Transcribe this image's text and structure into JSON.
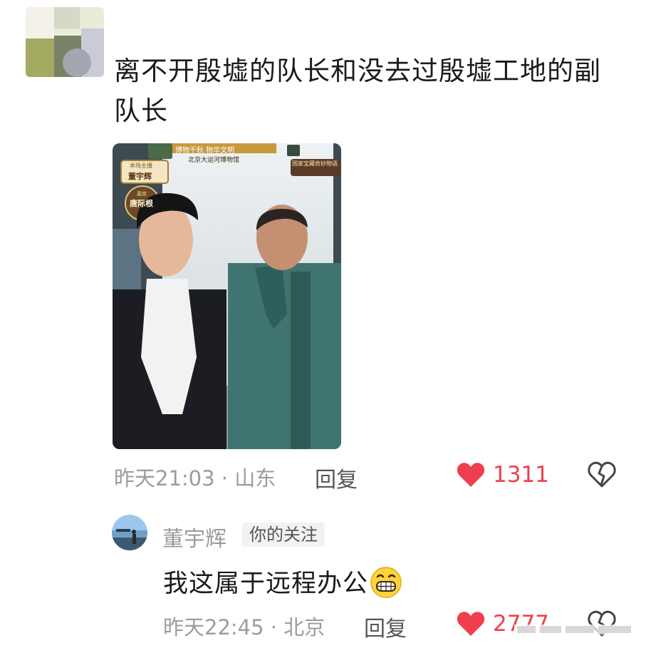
{
  "comments": [
    {
      "text": "离不开殷墟的队长和没去过殷墟工地的副队长",
      "timestamp": "昨天21:03",
      "location": "山东",
      "reply_label": "回复",
      "likes": "1311",
      "has_image": true,
      "image_overlay": {
        "top_banner": "博物千秋 物华文明",
        "museum": "北京大运河博物馆",
        "host_tag_title": "本场主播",
        "host_name": "董宇辉",
        "guest_tag_title": "嘉宾",
        "guest_name": "唐际根",
        "right_tag": "国家宝藏奇妙物语"
      }
    },
    {
      "username": "董宇辉",
      "badge": "你的关注",
      "text": "我这属于远程办公",
      "emoji": "grinning-face-emoji",
      "timestamp": "昨天22:45",
      "location": "北京",
      "reply_label": "回复",
      "likes": "2777"
    }
  ],
  "separator": "·",
  "colors": {
    "like_red": "#ef3f4f",
    "meta_gray": "#9c9c9c",
    "badge_bg": "#f2f2f2"
  },
  "icons": {
    "like": "heart-icon",
    "dislike": "broken-heart-icon"
  }
}
